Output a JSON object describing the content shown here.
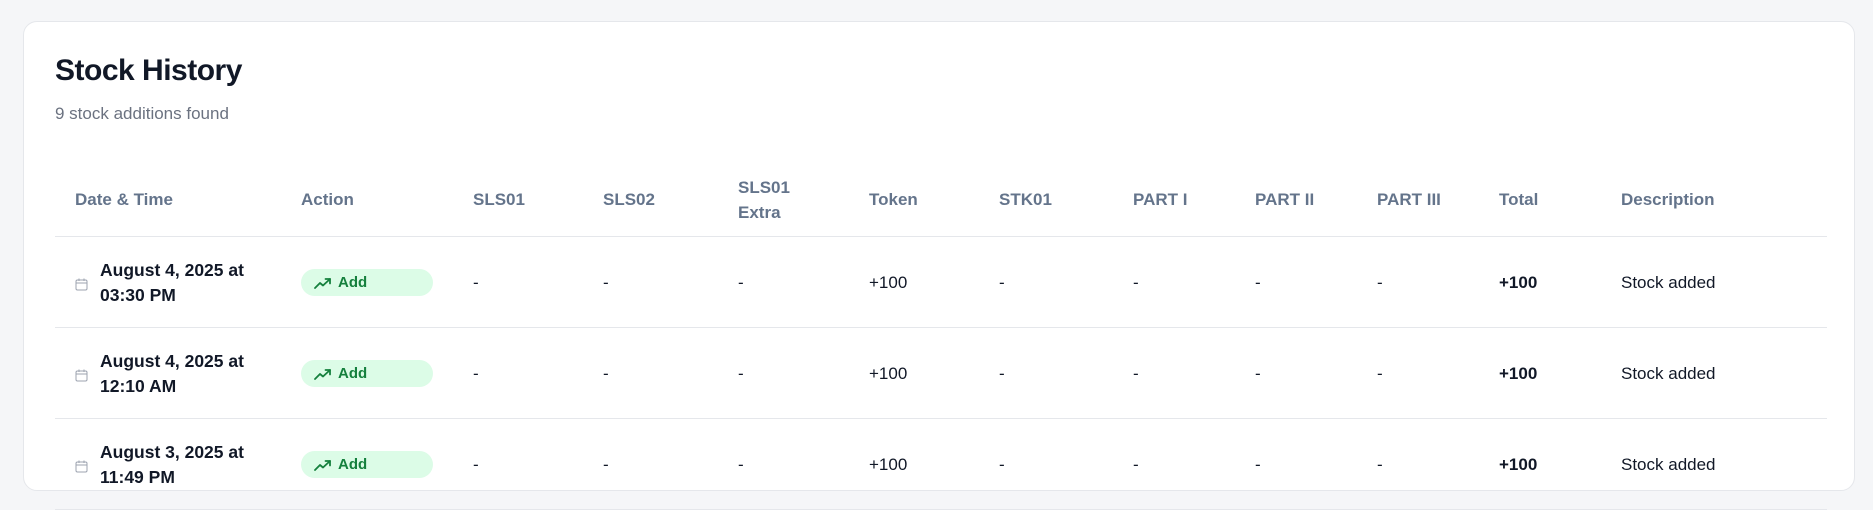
{
  "header": {
    "title": "Stock History",
    "subtitle": "9 stock additions found"
  },
  "colors": {
    "badge_bg": "#dcfce7",
    "badge_text": "#15803d",
    "header_text": "#64748b"
  },
  "table": {
    "columns": {
      "date": "Date & Time",
      "action": "Action",
      "sls01": "SLS01",
      "sls02": "SLS02",
      "sls01_extra": "SLS01 Extra",
      "token": "Token",
      "stk01": "STK01",
      "part1": "PART I",
      "part2": "PART II",
      "part3": "PART III",
      "total": "Total",
      "description": "Description"
    },
    "rows": [
      {
        "date": "August 4, 2025 at 03:30 PM",
        "action": "Add",
        "action_icon": "trending-up-icon",
        "sls01": "-",
        "sls02": "-",
        "sls01_extra": "-",
        "token": "+100",
        "stk01": "-",
        "part1": "-",
        "part2": "-",
        "part3": "-",
        "total": "+100",
        "description": "Stock added"
      },
      {
        "date": "August 4, 2025 at 12:10 AM",
        "action": "Add",
        "action_icon": "trending-up-icon",
        "sls01": "-",
        "sls02": "-",
        "sls01_extra": "-",
        "token": "+100",
        "stk01": "-",
        "part1": "-",
        "part2": "-",
        "part3": "-",
        "total": "+100",
        "description": "Stock added"
      },
      {
        "date": "August 3, 2025 at 11:49 PM",
        "action": "Add",
        "action_icon": "trending-up-icon",
        "sls01": "-",
        "sls02": "-",
        "sls01_extra": "-",
        "token": "+100",
        "stk01": "-",
        "part1": "-",
        "part2": "-",
        "part3": "-",
        "total": "+100",
        "description": "Stock added"
      }
    ]
  }
}
